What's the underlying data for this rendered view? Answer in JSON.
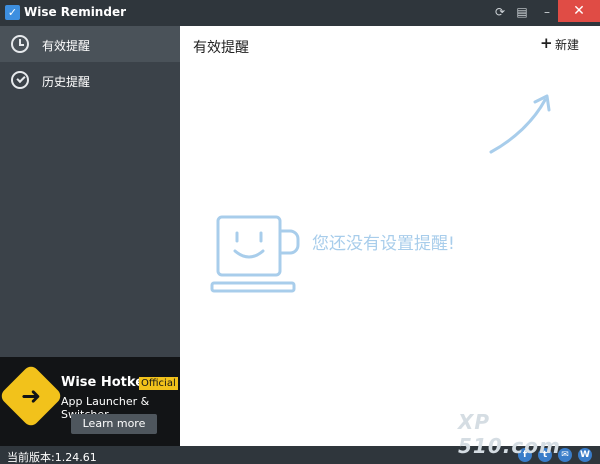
{
  "window": {
    "title": "Wise Reminder",
    "icon": "check-calendar-icon",
    "close_color": "#e04c45"
  },
  "sidebar": {
    "items": [
      {
        "label": "有效提醒",
        "icon": "alarm-clock-icon",
        "active": true
      },
      {
        "label": "历史提醒",
        "icon": "check-circle-icon",
        "active": false
      }
    ]
  },
  "promo": {
    "title": "Wise Hotkey",
    "badge": "Official",
    "subtitle": "App Launcher & Switcher",
    "button": "Learn more",
    "badge_color": "#f2c21b"
  },
  "main": {
    "title": "有效提醒",
    "add_label": "新建",
    "empty_message": "您还没有设置提醒!",
    "accent_color": "#a8cdeb"
  },
  "status": {
    "version": "当前版本:1.24.61"
  },
  "social": [
    "f",
    "t",
    "✉",
    "W"
  ],
  "watermark": "XP 510.com"
}
